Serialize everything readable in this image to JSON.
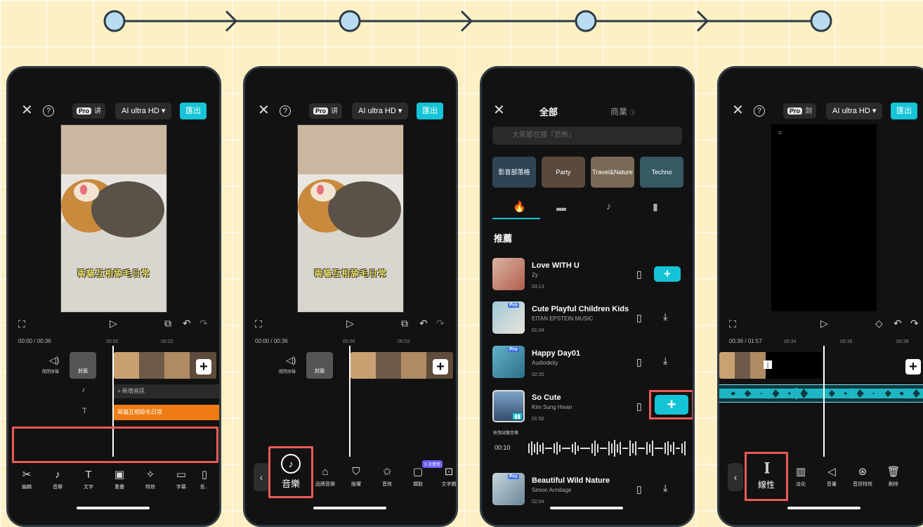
{
  "editor": {
    "pro_badge": "Pro",
    "pro_suffix_1": "讲",
    "pro_suffix_2": "讲",
    "pro_suffix_4": "剑",
    "quality_label": "AI ultra HD ▾",
    "export_label": "匯出",
    "subtitle": "兩貓互相舔毛日常",
    "time_1": "00:00 / 00:36",
    "time_4": "00:36 / 01:57",
    "ruler_1": [
      "00:00",
      "00:02"
    ],
    "ruler_4": [
      "00:34",
      "00:36",
      "00:38"
    ],
    "track_mute_label": "關閉原聲",
    "cover_label": "封面",
    "add_audio_label": "+ 新增音訊",
    "text_clip_label": "兩貓互相舔毛日常"
  },
  "toolbar_1": [
    {
      "label": "編輯",
      "icon": "scissors-icon",
      "glyph": "✂"
    },
    {
      "label": "音樂",
      "icon": "music-note-icon",
      "glyph": "♪"
    },
    {
      "label": "文字",
      "icon": "text-icon",
      "glyph": "T"
    },
    {
      "label": "重疊",
      "icon": "overlay-icon",
      "glyph": "▣"
    },
    {
      "label": "特效",
      "icon": "effects-icon",
      "glyph": "✧"
    },
    {
      "label": "字幕",
      "icon": "captions-icon",
      "glyph": "▭"
    },
    {
      "label": "長...",
      "icon": "more-icon",
      "glyph": "▯"
    }
  ],
  "toolbar_2": {
    "music_label": "音樂",
    "items": [
      {
        "label": "品牌音樂",
        "icon": "brand-music-icon",
        "glyph": "⌂"
      },
      {
        "label": "版權",
        "icon": "copyright-icon",
        "glyph": "⛉"
      },
      {
        "label": "音效",
        "icon": "sound-effect-icon",
        "glyph": "✩"
      },
      {
        "label": "擷取",
        "icon": "extract-icon",
        "glyph": "▢"
      },
      {
        "label": "文字朗",
        "icon": "tts-icon",
        "glyph": "⊡"
      }
    ],
    "badge": "3 次使用"
  },
  "toolbar_4": {
    "selected_label": "線性",
    "items": [
      {
        "label": "淡化",
        "icon": "fade-icon",
        "glyph": "▥"
      },
      {
        "label": "音量",
        "icon": "volume-icon",
        "glyph": "◁"
      },
      {
        "label": "音訊特效",
        "icon": "audio-effect-icon",
        "glyph": "⊛"
      },
      {
        "label": "刪除",
        "icon": "trash-icon",
        "glyph": "🗑"
      }
    ]
  },
  "music_library": {
    "tab_all": "全部",
    "tab_commercial": "商業",
    "search_placeholder": "大家都在搜「恐怖」",
    "categories": [
      "影音部落格",
      "Party",
      "Travel&Nature",
      "Techno"
    ],
    "section_title": "推薦",
    "songs": [
      {
        "title": "Love WITH U",
        "artist": "Zy",
        "duration": "03:13",
        "pro": false
      },
      {
        "title": "Cute Playful Children Kids",
        "artist": "EITAN EPSTEIN MUSIC",
        "duration": "01:04",
        "pro": true
      },
      {
        "title": "Happy Day01",
        "artist": "Audiodeity",
        "duration": "02:20",
        "pro": true
      },
      {
        "title": "So Cute",
        "artist": "Kim Sung Hwan",
        "duration": "01:56",
        "pro": false
      },
      {
        "title": "Beautiful Wild Nature",
        "artist": "Simon Armitage",
        "duration": "02:04",
        "pro": true
      }
    ],
    "drag_hint": "拖曳試聽音樂",
    "preview_time": "00:10",
    "pro_badge": "Pro"
  },
  "colors": {
    "accent": "#15c4d6",
    "highlight": "#ea5a57",
    "background": "#fdf0c4",
    "text_clip": "#ef7b12",
    "waveform": "#1fb6c4"
  }
}
